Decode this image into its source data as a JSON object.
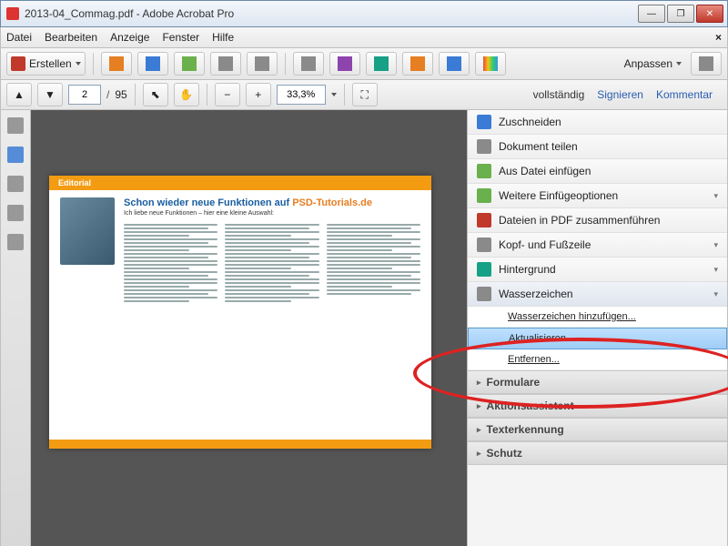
{
  "window": {
    "title": "2013-04_Commag.pdf - Adobe Acrobat Pro",
    "min": "—",
    "max": "❐",
    "close": "✕"
  },
  "menu": {
    "datei": "Datei",
    "bearbeiten": "Bearbeiten",
    "anzeige": "Anzeige",
    "fenster": "Fenster",
    "hilfe": "Hilfe",
    "close": "×"
  },
  "toolbar": {
    "create": "Erstellen",
    "customize": "Anpassen"
  },
  "nav": {
    "page": "2",
    "total": "95",
    "zoom": "33,3%",
    "vollstaendig": "vollständig",
    "signieren": "Signieren",
    "kommentar": "Kommentar"
  },
  "doc": {
    "editorial": "Editorial",
    "headline_a": "Schon wieder neue Funktionen auf ",
    "headline_b": "PSD-Tutorials.de",
    "sub": "Ich liebe neue Funktionen – hier eine kleine Auswahl:"
  },
  "panel": {
    "items": [
      {
        "label": "Zuschneiden",
        "icon": "c-blue"
      },
      {
        "label": "Dokument teilen",
        "icon": "c-gray"
      },
      {
        "label": "Aus Datei einfügen",
        "icon": "c-green"
      },
      {
        "label": "Weitere Einfügeoptionen",
        "icon": "c-green",
        "chev": true
      },
      {
        "label": "Dateien in PDF zusammenführen",
        "icon": "c-red"
      },
      {
        "label": "Kopf- und Fußzeile",
        "icon": "c-gray",
        "chev": true
      },
      {
        "label": "Hintergrund",
        "icon": "c-teal",
        "chev": true
      }
    ],
    "wasserzeichen": "Wasserzeichen",
    "sub": {
      "add": "Wasserzeichen hinzufügen...",
      "update": "Aktualisieren...",
      "remove": "Entfernen..."
    },
    "accordion": [
      "Formulare",
      "Aktionsassistent",
      "Texterkennung",
      "Schutz"
    ],
    "tri": "▸"
  }
}
